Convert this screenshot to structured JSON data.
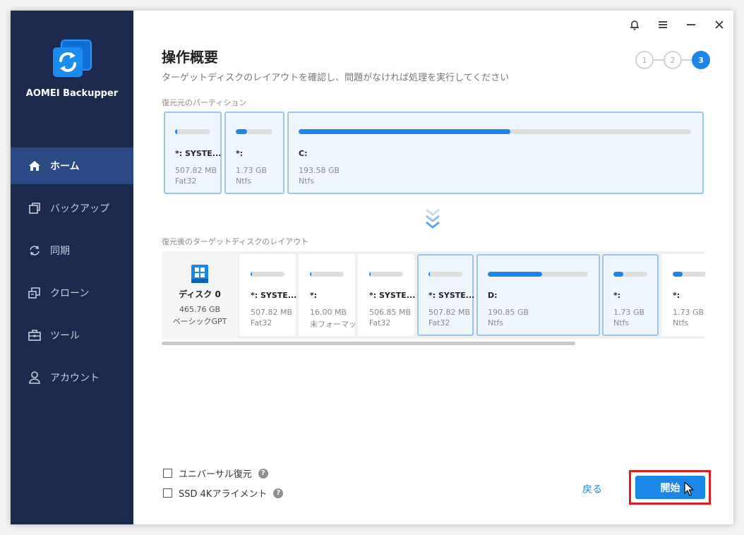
{
  "app": {
    "name": "AOMEI Backupper"
  },
  "sidebar": {
    "items": [
      {
        "label": "ホーム",
        "icon": "home-icon",
        "active": true
      },
      {
        "label": "バックアップ",
        "icon": "copy-icon",
        "active": false
      },
      {
        "label": "同期",
        "icon": "sync-icon",
        "active": false
      },
      {
        "label": "クローン",
        "icon": "clone-icon",
        "active": false
      },
      {
        "label": "ツール",
        "icon": "toolbox-icon",
        "active": false
      },
      {
        "label": "アカウント",
        "icon": "user-icon",
        "active": false
      }
    ]
  },
  "titlebar": {
    "icons": [
      "bell-icon",
      "menu-icon",
      "minimize-icon",
      "close-icon"
    ]
  },
  "header": {
    "title": "操作概要",
    "subtitle": "ターゲットディスクのレイアウトを確認し、問題がなければ処理を実行してください"
  },
  "steps": {
    "items": [
      "1",
      "2",
      "3"
    ],
    "current": 3
  },
  "source": {
    "label": "復元元のパーティション",
    "partitions": [
      {
        "name": "*: SYSTE...",
        "size": "507.82 MB",
        "fs": "Fat32",
        "used": 0.05
      },
      {
        "name": "*:",
        "size": "1.73 GB",
        "fs": "Ntfs",
        "used": 0.3
      },
      {
        "name": "C:",
        "size": "193.58 GB",
        "fs": "Ntfs",
        "used": 0.54
      }
    ]
  },
  "target": {
    "label": "復元後のターゲットディスクのレイアウト",
    "disk": {
      "name": "ディスク 0",
      "size": "465.76 GB",
      "type": "ベーシックGPT"
    },
    "partitions": [
      {
        "name": "*: SYSTE...",
        "size": "507.82 MB",
        "fs": "Fat32",
        "used": 0.05,
        "selected": false
      },
      {
        "name": "*:",
        "size": "16.00 MB",
        "fs": "未フォーマット",
        "used": 0.05,
        "selected": false
      },
      {
        "name": "*: SYSTE...",
        "size": "506.85 MB",
        "fs": "Fat32",
        "used": 0.05,
        "selected": false
      },
      {
        "name": "*: SYSTE...",
        "size": "507.82 MB",
        "fs": "Fat32",
        "used": 0.05,
        "selected": true
      },
      {
        "name": "D:",
        "size": "190.85 GB",
        "fs": "Ntfs",
        "used": 0.54,
        "selected": true
      },
      {
        "name": "*:",
        "size": "1.73 GB",
        "fs": "Ntfs",
        "used": 0.3,
        "selected": true
      },
      {
        "name": "*:",
        "size": "1.73 GB",
        "fs": "Ntfs",
        "used": 0.3,
        "selected": false
      }
    ]
  },
  "options": {
    "universal_restore": "ユニバーサル復元",
    "ssd_align": "SSD 4Kアライメント",
    "help": "?"
  },
  "footer": {
    "back": "戻る",
    "start": "開始"
  },
  "colors": {
    "accent": "#1a86e8",
    "sidebar": "#1b2a4d",
    "sidebar_active": "#2a4a86",
    "highlight": "#e21b23"
  }
}
